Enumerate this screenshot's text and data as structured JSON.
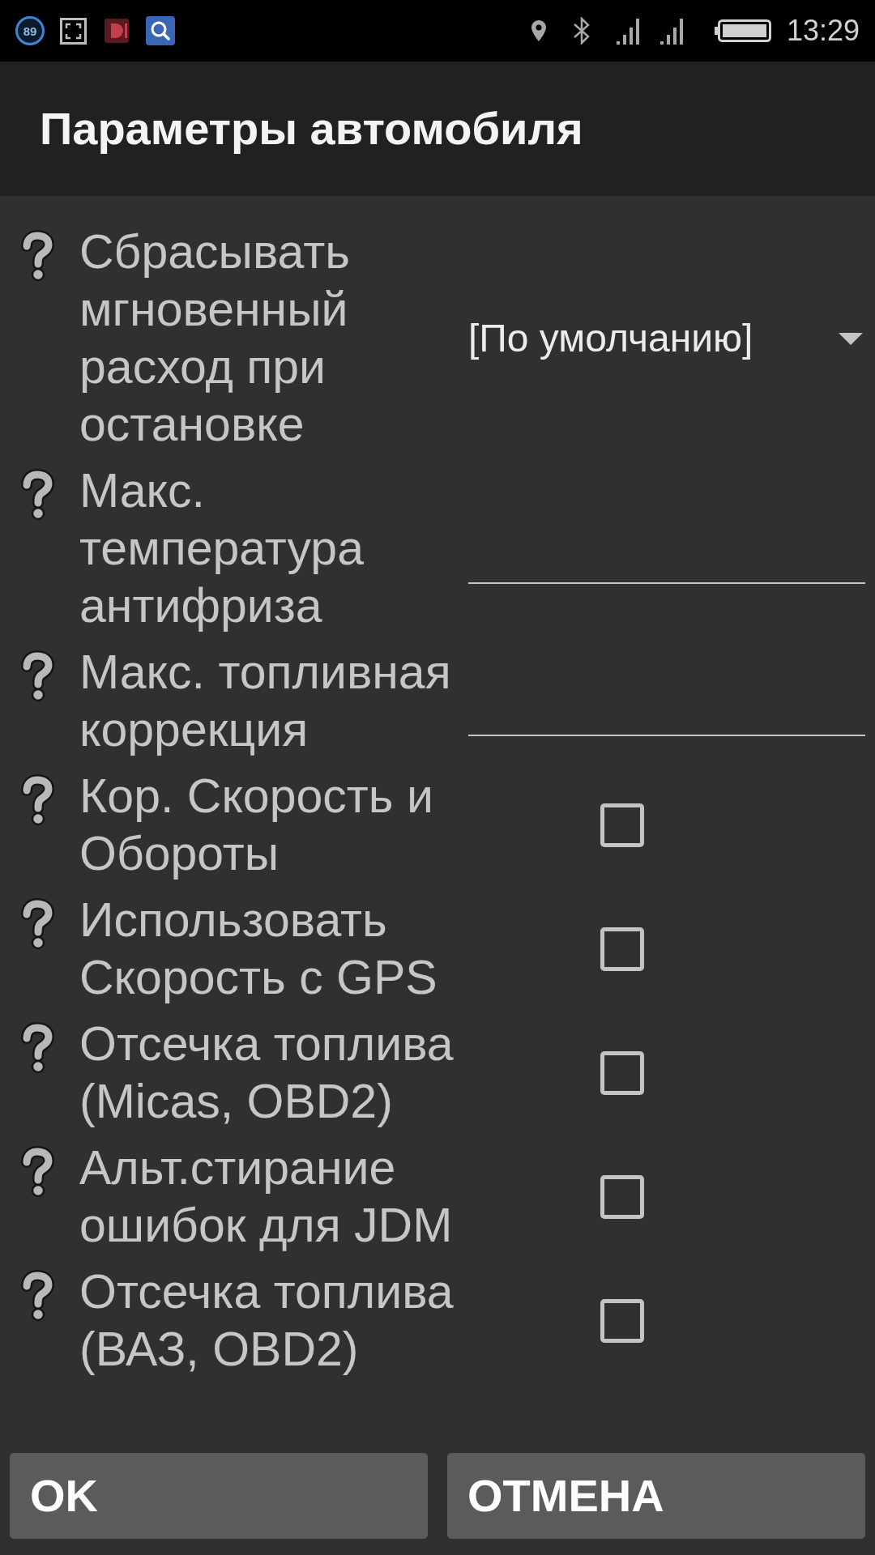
{
  "status_bar": {
    "badge": "89",
    "time": "13:29"
  },
  "title": "Параметры автомобиля",
  "settings": [
    {
      "kind": "dropdown",
      "label": "Сбрасывать мгновенный расход при остановке",
      "value": "[По умолчанию]"
    },
    {
      "kind": "input",
      "label": "Макс. температура антифриза"
    },
    {
      "kind": "input",
      "label": "Макс. топливная коррекция"
    },
    {
      "kind": "checkbox",
      "label": "Кор. Скорость и Обороты",
      "checked": false
    },
    {
      "kind": "checkbox",
      "label": "Использовать Скорость с GPS",
      "checked": false
    },
    {
      "kind": "checkbox",
      "label": "Отсечка топлива (Micas, OBD2)",
      "checked": false
    },
    {
      "kind": "checkbox",
      "label": "Альт.стирание ошибок для JDM",
      "checked": false
    },
    {
      "kind": "checkbox",
      "label": "Отсечка топлива (ВАЗ, OBD2)",
      "checked": false
    }
  ],
  "buttons": [
    {
      "label": "OK"
    },
    {
      "label": "ОТМЕНА"
    }
  ]
}
